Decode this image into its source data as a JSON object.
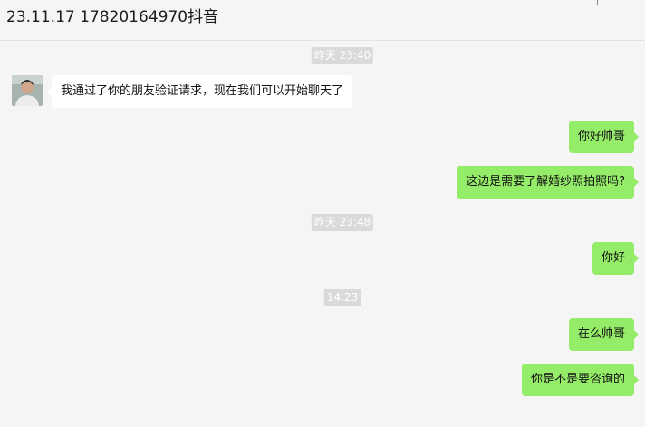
{
  "chat": {
    "title": "23.11.17 17820164970抖音",
    "messages": [
      {
        "type": "time",
        "text": "昨天 23:40"
      },
      {
        "type": "in",
        "text": "我通过了你的朋友验证请求，现在我们可以开始聊天了"
      },
      {
        "type": "out",
        "text": "你好帅哥"
      },
      {
        "type": "out",
        "text": "这边是需要了解婚纱照拍照吗?"
      },
      {
        "type": "time",
        "text": "昨天 23:48"
      },
      {
        "type": "out",
        "text": "你好"
      },
      {
        "type": "time",
        "text": "14:23"
      },
      {
        "type": "out",
        "text": "在么帅哥"
      },
      {
        "type": "out",
        "text": "你是不是要咨询的"
      }
    ]
  },
  "colors": {
    "background": "#f5f5f5",
    "outgoing_bubble": "#95ec69",
    "incoming_bubble": "#ffffff",
    "timestamp_bg": "#dadada"
  }
}
